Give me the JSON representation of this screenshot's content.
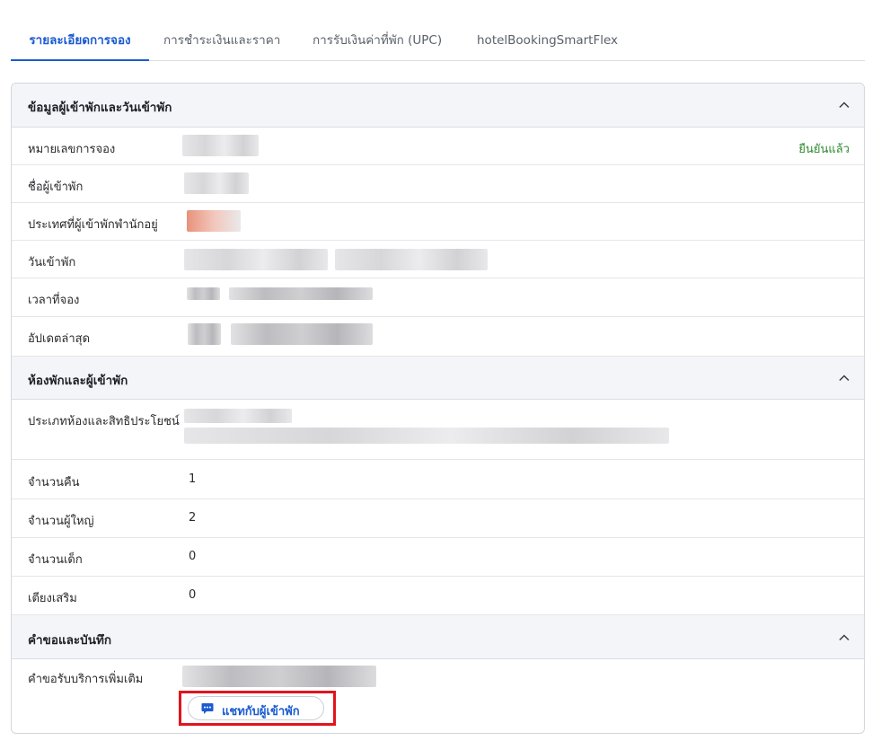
{
  "tabs": [
    {
      "label": "รายละเอียดการจอง",
      "active": true
    },
    {
      "label": "การชำระเงินและราคา",
      "active": false
    },
    {
      "label": "การรับเงินค่าที่พัก (UPC)",
      "active": false
    },
    {
      "label": "hotelBookingSmartFlex",
      "active": false
    }
  ],
  "sections": {
    "guest_info": {
      "title": "ข้อมูลผู้เข้าพักและวันเข้าพัก",
      "rows": {
        "booking_number": {
          "label": "หมายเลขการจอง",
          "status": "ยืนยันแล้ว"
        },
        "guest_name": {
          "label": "ชื่อผู้เข้าพัก"
        },
        "residence_country": {
          "label": "ประเทศที่ผู้เข้าพักพำนักอยู่"
        },
        "stay_dates": {
          "label": "วันเข้าพัก"
        },
        "booking_time": {
          "label": "เวลาที่จอง"
        },
        "last_updated": {
          "label": "อัปเดตล่าสุด"
        }
      }
    },
    "room_guests": {
      "title": "ห้องพักและผู้เข้าพัก",
      "rows": {
        "room_type": {
          "label": "ประเภทห้องและสิทธิประโยชน์"
        },
        "nights": {
          "label": "จำนวนคืน",
          "value": "1"
        },
        "adults": {
          "label": "จำนวนผู้ใหญ่",
          "value": "2"
        },
        "children": {
          "label": "จำนวนเด็ก",
          "value": "0"
        },
        "extra_beds": {
          "label": "เตียงเสริม",
          "value": "0"
        }
      }
    },
    "requests_notes": {
      "title": "คำขอและบันทึก",
      "rows": {
        "special_requests": {
          "label": "คำขอรับบริการเพิ่มเติม"
        }
      },
      "chat_button": {
        "label": "แชทกับผู้เข้าพัก"
      }
    }
  },
  "colors": {
    "accent": "#1a5bd1",
    "status_confirmed": "#2e8a2e",
    "highlight_border": "#e1141c"
  },
  "icons": {
    "collapse": "chevron-up-icon",
    "chat": "chat-bubble-icon"
  }
}
